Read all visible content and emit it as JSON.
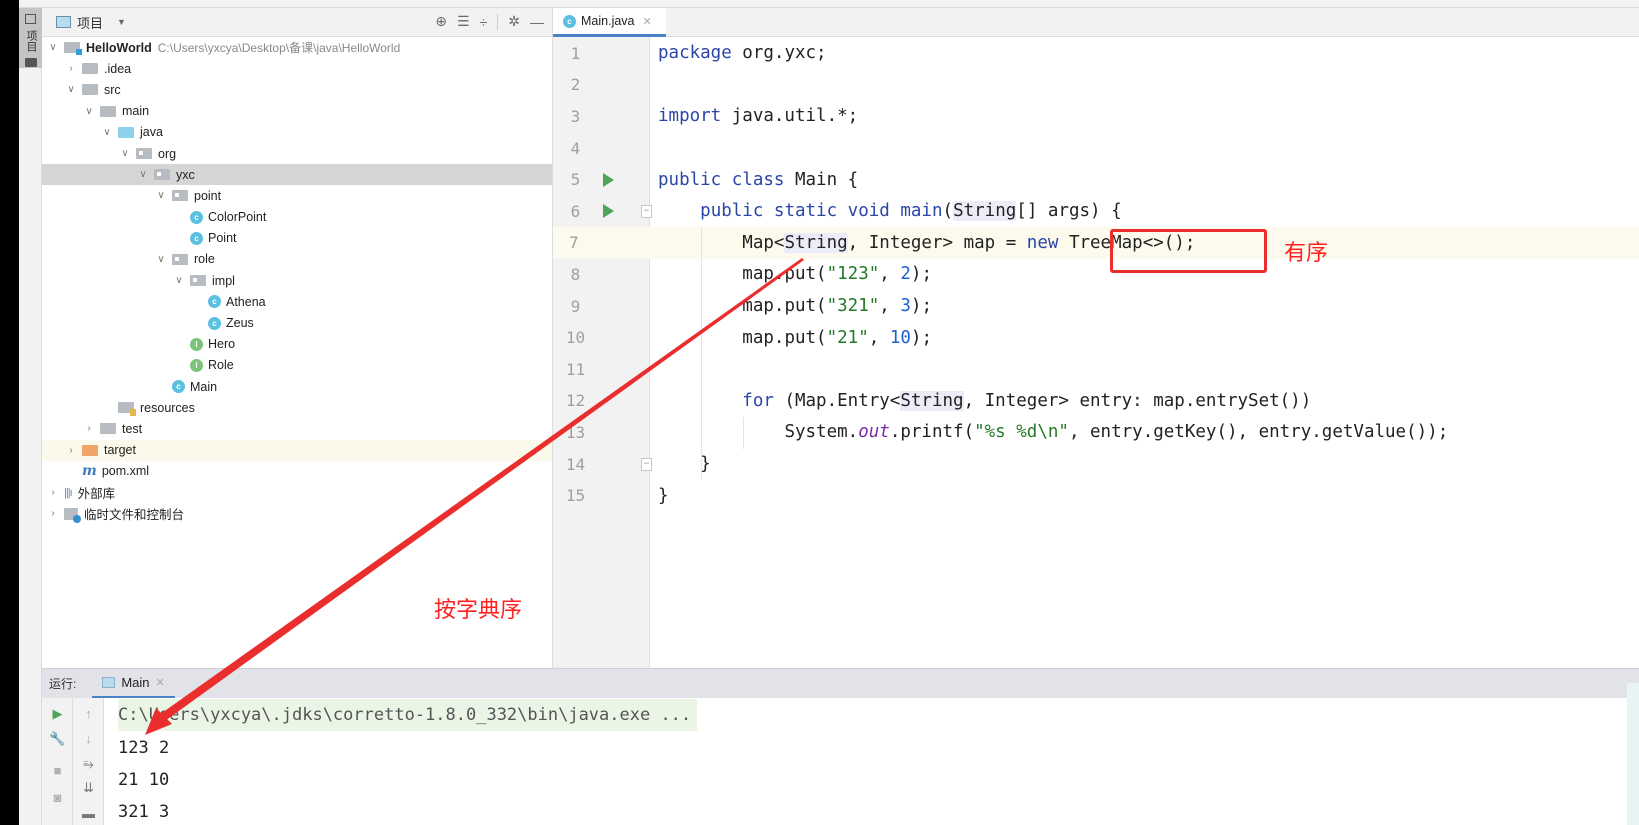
{
  "side_tab": {
    "label": "项目"
  },
  "project": {
    "title": "项目",
    "tools": [
      "locate-icon",
      "expand-all-icon",
      "collapse-all-icon",
      "gear-icon",
      "minimize-icon"
    ],
    "tree": [
      {
        "name": "HelloWorld",
        "path": "C:\\Users\\yxcya\\Desktop\\备课\\java\\HelloWorld"
      },
      {
        "name": ".idea"
      },
      {
        "name": "src"
      },
      {
        "name": "main"
      },
      {
        "name": "java"
      },
      {
        "name": "org"
      },
      {
        "name": "yxc"
      },
      {
        "name": "point"
      },
      {
        "name": "ColorPoint"
      },
      {
        "name": "Point"
      },
      {
        "name": "role"
      },
      {
        "name": "impl"
      },
      {
        "name": "Athena"
      },
      {
        "name": "Zeus"
      },
      {
        "name": "Hero"
      },
      {
        "name": "Role"
      },
      {
        "name": "Main"
      },
      {
        "name": "resources"
      },
      {
        "name": "test"
      },
      {
        "name": "target"
      },
      {
        "name": "pom.xml"
      },
      {
        "name": "外部库"
      },
      {
        "name": "临时文件和控制台"
      }
    ]
  },
  "editor": {
    "tab": {
      "label": "Main.java"
    },
    "lines": [
      {
        "n": "1"
      },
      {
        "n": "2"
      },
      {
        "n": "3"
      },
      {
        "n": "4"
      },
      {
        "n": "5"
      },
      {
        "n": "6"
      },
      {
        "n": "7"
      },
      {
        "n": "8"
      },
      {
        "n": "9"
      },
      {
        "n": "10"
      },
      {
        "n": "11"
      },
      {
        "n": "12"
      },
      {
        "n": "13"
      },
      {
        "n": "14"
      },
      {
        "n": "15"
      }
    ],
    "code": {
      "l1": [
        "package",
        " org.yxc;"
      ],
      "l3": [
        "import",
        " java.util.*;"
      ],
      "l5": [
        "public class",
        " Main {"
      ],
      "l6": [
        "public static void",
        " ",
        "main",
        "(",
        "String",
        "[] args) {"
      ],
      "l7": [
        "Map<",
        "String",
        ", Integer> map = ",
        "new",
        " TreeMap<>();"
      ],
      "l8": [
        "map.put(",
        "\"123\"",
        ", ",
        "2",
        ");"
      ],
      "l9": [
        "map.put(",
        "\"321\"",
        ", ",
        "3",
        ");"
      ],
      "l10": [
        "map.put(",
        "\"21\"",
        ", ",
        "10",
        ");"
      ],
      "l12": [
        "for",
        " (Map.Entry<",
        "String",
        ", Integer> entry: map.entrySet())"
      ],
      "l13": [
        "System.",
        "out",
        ".printf(",
        "\"%s %d\\n\"",
        ", entry.getKey(), entry.getValue());"
      ],
      "l14": [
        "}"
      ],
      "l15": [
        "}"
      ]
    }
  },
  "annotations": {
    "ordered": "有序",
    "lexicographic": "按字典序",
    "color": "#ea2d2d"
  },
  "run_panel": {
    "label": "运行:",
    "tab": "Main",
    "command": "C:\\Users\\yxcya\\.jdks\\corretto-1.8.0_332\\bin\\java.exe ...",
    "output": [
      "123 2",
      "21 10",
      "321 3"
    ]
  }
}
